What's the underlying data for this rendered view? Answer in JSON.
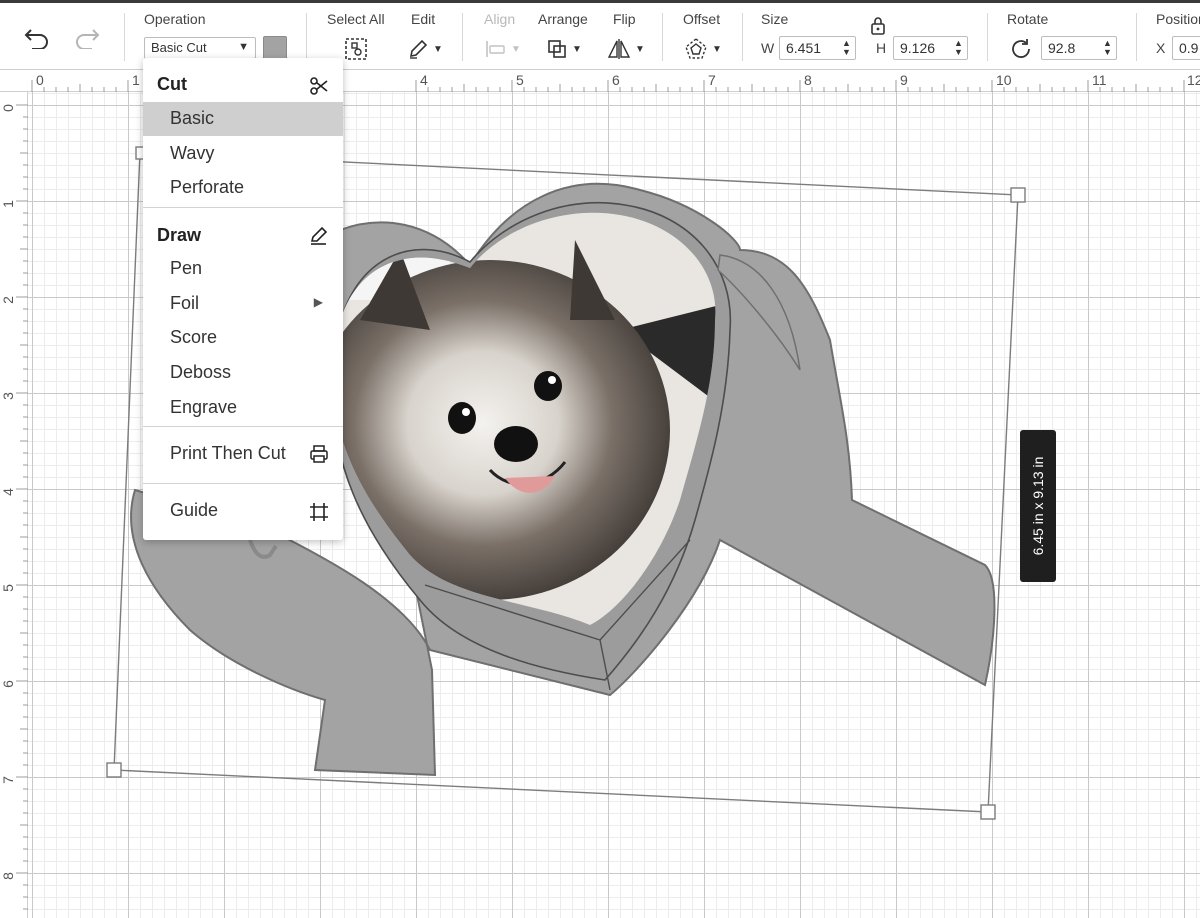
{
  "toolbar": {
    "operation_label": "Operation",
    "operation_value": "Basic Cut",
    "operation_color": "#a3a3a3",
    "select_all_label": "Select All",
    "edit_label": "Edit",
    "align_label": "Align",
    "arrange_label": "Arrange",
    "flip_label": "Flip",
    "offset_label": "Offset",
    "size_label": "Size",
    "width_prefix": "W",
    "width_value": "6.451",
    "height_prefix": "H",
    "height_value": "9.126",
    "rotate_label": "Rotate",
    "rotate_value": "92.8",
    "position_label": "Position",
    "position_x_prefix": "X",
    "position_x_value": "0.9"
  },
  "menu": {
    "cut_heading": "Cut",
    "cut_items": [
      "Basic",
      "Wavy",
      "Perforate"
    ],
    "selected_item": "Basic",
    "draw_heading": "Draw",
    "draw_items": [
      "Pen",
      "Foil",
      "Score",
      "Deboss",
      "Engrave"
    ],
    "print_then_cut": "Print Then Cut",
    "guide": "Guide"
  },
  "ruler": {
    "top": [
      "0",
      "1",
      "4",
      "5",
      "6",
      "7",
      "8",
      "9",
      "10",
      "11",
      "12"
    ],
    "left": [
      "0",
      "1",
      "2",
      "3",
      "4",
      "5",
      "6",
      "7",
      "8"
    ]
  },
  "canvas": {
    "size_tooltip": "6.45  in x 9.13  in",
    "shape_fill": "#a3a3a3",
    "grid_color": "#c9c9c9"
  }
}
